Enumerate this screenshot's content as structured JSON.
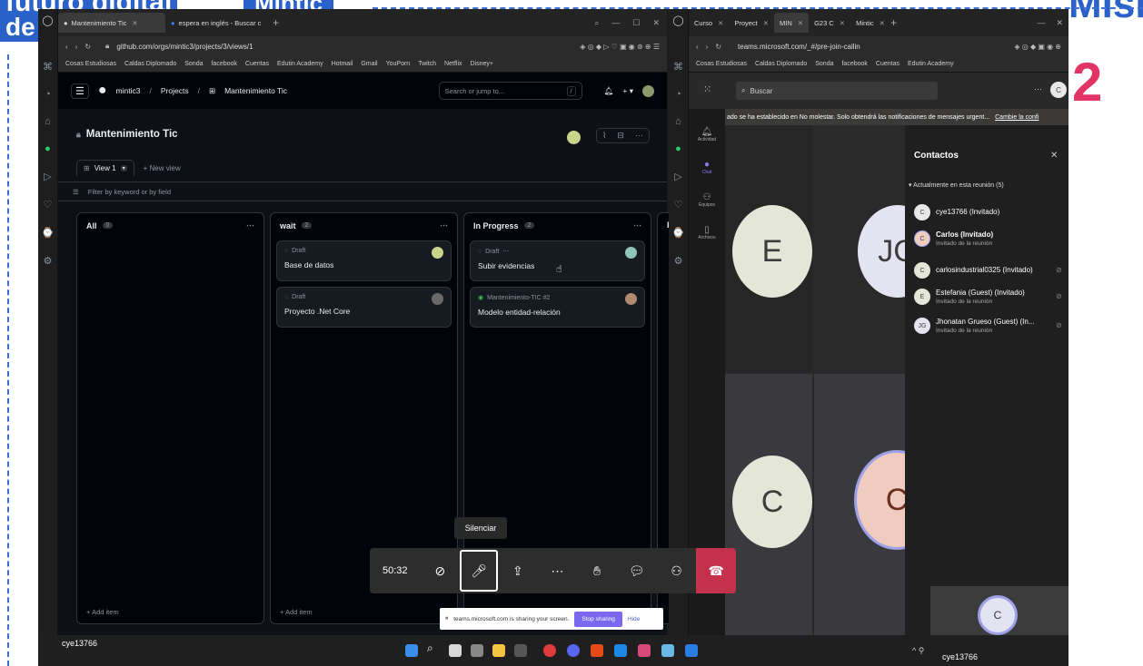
{
  "background": {
    "text_top_left_1": "futuro digital",
    "text_top_left_2": "de",
    "text_top_center": "Mintic",
    "text_top_right": "Misión",
    "number_right": "2"
  },
  "left_browser": {
    "tabs": [
      {
        "label": "Mantenimiento Tic",
        "active": true
      },
      {
        "label": "espera en inglés - Buscar c",
        "active": false
      }
    ],
    "url": "github.com/orgs/mintic3/projects/3/views/1",
    "bookmarks": [
      "Cosas Estudiosas",
      "Caldas Diplomado",
      "Sonda",
      "facebook",
      "Cuentas",
      "Edutin Academy",
      "Hotmail",
      "Gmail",
      "YouPorn",
      "Twitch",
      "Netflix",
      "Disney+"
    ]
  },
  "github": {
    "breadcrumb": [
      "mintic3",
      "Projects",
      "Mantenimiento Tic"
    ],
    "search_placeholder": "Search or jump to...",
    "search_shortcut": "/",
    "project_title": "Mantenimiento Tic",
    "view_tab": "View 1",
    "new_view": "New view",
    "filter_placeholder": "Filter by keyword or by field",
    "columns": [
      {
        "name": "All",
        "count": "0",
        "cards": [],
        "add_item": "Add item"
      },
      {
        "name": "wait",
        "count": "2",
        "add_item": "Add item",
        "cards": [
          {
            "meta": "Draft",
            "title": "Base de datos"
          },
          {
            "meta": "Draft",
            "title": "Proyecto .Net Core"
          }
        ]
      },
      {
        "name": "In Progress",
        "count": "2",
        "add_item": "",
        "cards": [
          {
            "meta": "Draft",
            "title": "Subir evidencias"
          },
          {
            "meta": "Mantenimiento-TIC #2",
            "title": "Modelo entidad-relación"
          }
        ]
      },
      {
        "name": "D",
        "count": "",
        "cards": []
      }
    ]
  },
  "right_browser": {
    "tabs": [
      "Curso",
      "Proyect",
      "MIN",
      "G23 C",
      "Mintic"
    ],
    "url": "teams.microsoft.com/_#/pre-join-callin",
    "bookmarks": [
      "Cosas Estudiosas",
      "Caldas Diplomado",
      "Sonda",
      "facebook",
      "Cuentas",
      "Edutin Academy"
    ]
  },
  "teams": {
    "search_placeholder": "Buscar",
    "user_initial": "C",
    "banner": "ado se ha establecido en No molestar. Solo obtendrá las notificaciones de mensajes urgent...",
    "banner_link": "Cambie la confi",
    "rail": [
      "Actividad",
      "Chat",
      "Equipos",
      "Archivos"
    ],
    "tiles": [
      "E",
      "JG",
      "C",
      "C"
    ],
    "contacts_title": "Contactos",
    "section_label": "Actualmente en esta reunión (5)",
    "contacts": [
      {
        "initial": "C",
        "name": "cye13766 (Invitado)",
        "sub": ""
      },
      {
        "initial": "C",
        "name": "Carlos (Invitado)",
        "sub": "Invitado de la reunión"
      },
      {
        "initial": "C",
        "name": "carlosindustrial0325 (Invitado)",
        "sub": ""
      },
      {
        "initial": "E",
        "name": "Estefania (Guest) (Invitado)",
        "sub": "Invitado de la reunión"
      },
      {
        "initial": "JG",
        "name": "Jhonatan Grueso (Guest) (In...",
        "sub": "Invitado de la reunión"
      }
    ],
    "self_initial": "C",
    "self_name": "cye13766"
  },
  "call_controls": {
    "timer": "50:32",
    "tooltip": "Silenciar"
  },
  "share_bar": {
    "text": "teams.microsoft.com is sharing your screen.",
    "stop_label": "Stop sharing",
    "hide_label": "Hide"
  },
  "taskbar": {
    "user_label": "cye13766"
  },
  "colors": {
    "github_bg": "#0d1117",
    "hangup": "#c4314b",
    "stop_sharing": "#7b68ee",
    "dash": "#3a6fd4"
  }
}
